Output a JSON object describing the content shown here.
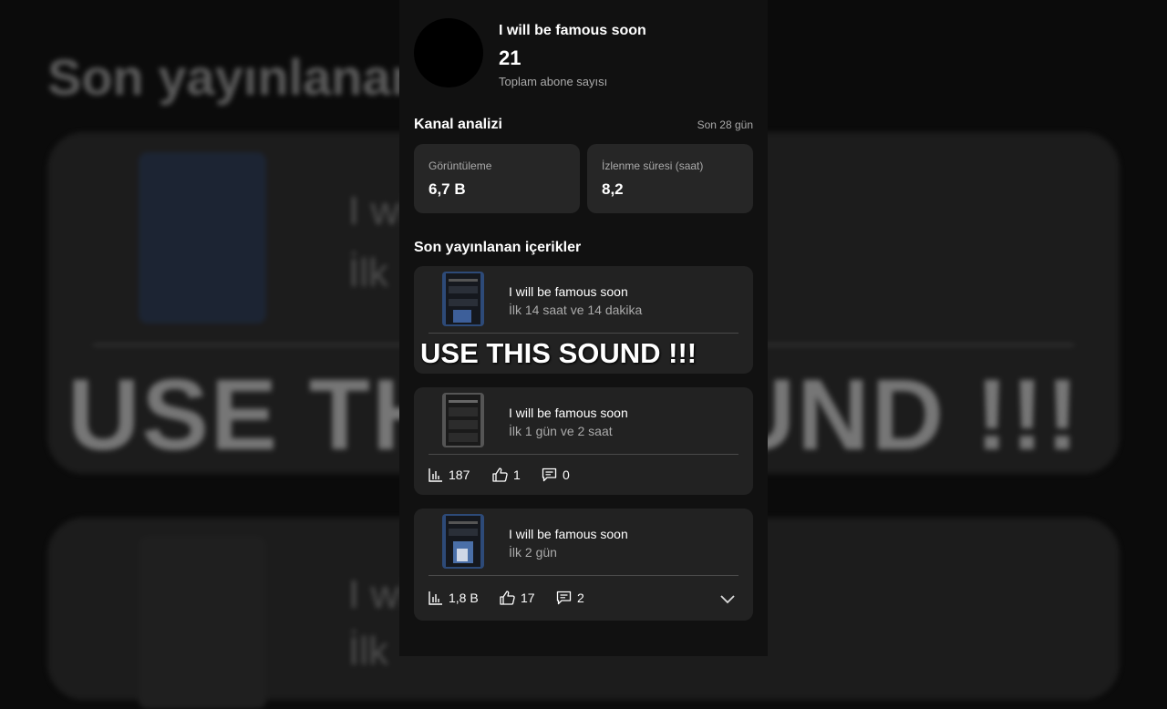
{
  "background": {
    "title": "Son yayınlanan",
    "text1": "I wi",
    "text2": "İlk",
    "overlay_big": "USE THIS SOUND !!!"
  },
  "channel": {
    "name": "I will be famous soon",
    "subscriber_count": "21",
    "subscriber_label": "Toplam abone sayısı"
  },
  "analytics": {
    "title": "Kanal analizi",
    "period": "Son 28 gün",
    "stats": [
      {
        "label": "Görüntüleme",
        "value": "6,7 B"
      },
      {
        "label": "İzlenme süresi (saat)",
        "value": "8,2"
      }
    ]
  },
  "recent": {
    "title": "Son yayınlanan içerikler",
    "videos": [
      {
        "title": "I will be famous soon",
        "subtitle": "İlk 14 saat ve 14 dakika",
        "views": "",
        "likes": "",
        "comments": ""
      },
      {
        "title": "I will be famous soon",
        "subtitle": "İlk 1 gün ve 2 saat",
        "views": "187",
        "likes": "1",
        "comments": "0"
      },
      {
        "title": "I will be famous soon",
        "subtitle": "İlk 2 gün",
        "views": "1,8 B",
        "likes": "17",
        "comments": "2"
      }
    ]
  },
  "overlay_caption": "USE THIS SOUND !!!",
  "icons": {
    "views": "bar-chart-icon",
    "likes": "thumbs-up-icon",
    "comments": "comment-icon",
    "expand": "chevron-down-icon"
  },
  "colors": {
    "panel_bg": "#111111",
    "card_bg": "#222222",
    "secondary_text": "#aaaaaa"
  }
}
